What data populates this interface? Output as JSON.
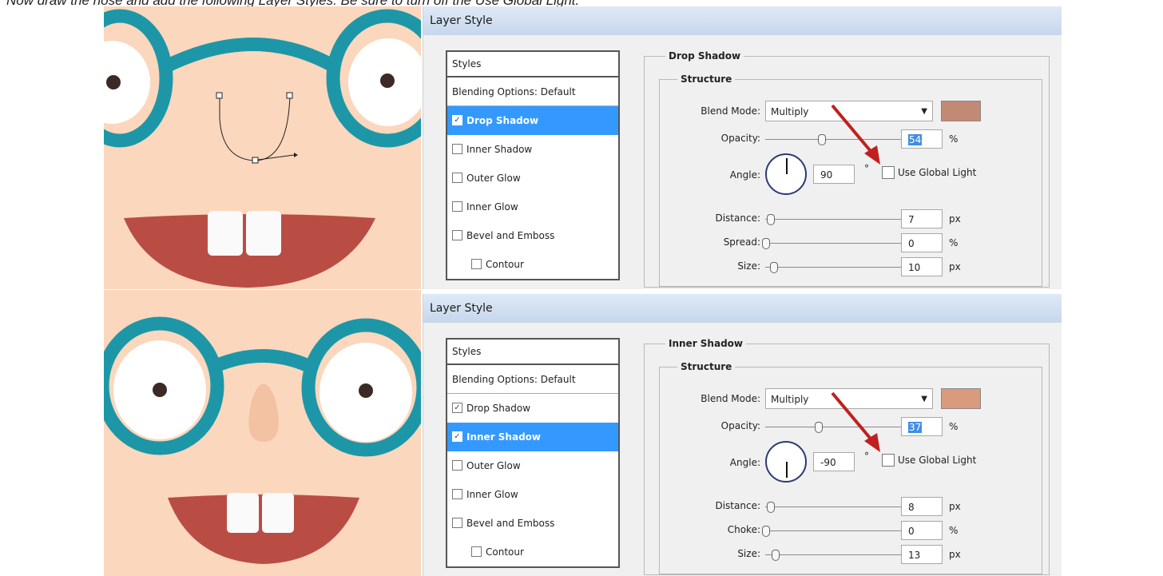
{
  "caption": "Now draw the nose and add the following Layer Styles. Be sure to turn off the Use Global Light.",
  "dialogs": [
    {
      "title": "Layer Style",
      "styles_header": "Styles",
      "blending_options": "Blending Options: Default",
      "style_items": [
        {
          "label": "Drop Shadow",
          "checked": true,
          "active": true
        },
        {
          "label": "Inner Shadow",
          "checked": false,
          "active": false
        },
        {
          "label": "Outer Glow",
          "checked": false,
          "active": false
        },
        {
          "label": "Inner Glow",
          "checked": false,
          "active": false
        },
        {
          "label": "Bevel and Emboss",
          "checked": false,
          "active": false
        },
        {
          "label": "Contour",
          "checked": false,
          "active": false
        }
      ],
      "group_title": "Drop Shadow",
      "structure_title": "Structure",
      "blend_mode_label": "Blend Mode:",
      "blend_mode": "Multiply",
      "swatch_color": "#c28a74",
      "opacity_label": "Opacity:",
      "opacity": "54",
      "opacity_unit": "%",
      "angle_label": "Angle:",
      "angle": "90",
      "degree": "°",
      "use_global_light": "Use Global Light",
      "distance_label": "Distance:",
      "distance": "7",
      "distance_unit": "px",
      "third_label": "Spread:",
      "third_value": "0",
      "third_unit": "%",
      "size_label": "Size:",
      "size": "10",
      "size_unit": "px"
    },
    {
      "title": "Layer Style",
      "styles_header": "Styles",
      "blending_options": "Blending Options: Default",
      "style_items": [
        {
          "label": "Drop Shadow",
          "checked": true,
          "active": false
        },
        {
          "label": "Inner Shadow",
          "checked": true,
          "active": true
        },
        {
          "label": "Outer Glow",
          "checked": false,
          "active": false
        },
        {
          "label": "Inner Glow",
          "checked": false,
          "active": false
        },
        {
          "label": "Bevel and Emboss",
          "checked": false,
          "active": false
        },
        {
          "label": "Contour",
          "checked": false,
          "active": false
        }
      ],
      "group_title": "Inner Shadow",
      "structure_title": "Structure",
      "blend_mode_label": "Blend Mode:",
      "blend_mode": "Multiply",
      "swatch_color": "#d99a7e",
      "opacity_label": "Opacity:",
      "opacity": "37",
      "opacity_unit": "%",
      "angle_label": "Angle:",
      "angle": "-90",
      "degree": "°",
      "use_global_light": "Use Global Light",
      "distance_label": "Distance:",
      "distance": "8",
      "distance_unit": "px",
      "third_label": "Choke:",
      "third_value": "0",
      "third_unit": "%",
      "size_label": "Size:",
      "size": "13",
      "size_unit": "px"
    }
  ],
  "colors": {
    "skin": "#fbd7bd",
    "glasses": "#1d97a8",
    "mouth": "#b94d43",
    "teeth": "#fafafa",
    "highlight": "#3399ff",
    "arrow": "#c0201e"
  }
}
